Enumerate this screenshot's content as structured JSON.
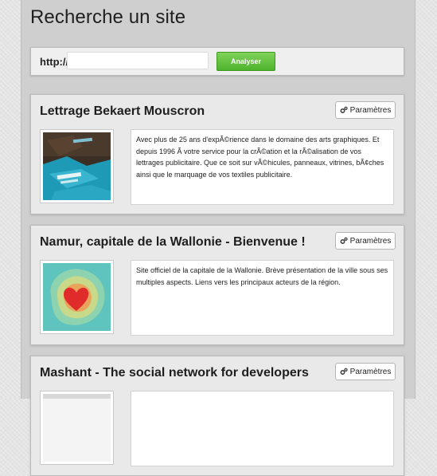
{
  "page": {
    "title": "Recherche un site"
  },
  "search": {
    "label": "http://",
    "value": "",
    "placeholder": "",
    "button_label": "Analyser"
  },
  "results": [
    {
      "title": "Lettrage Bekaert Mouscron",
      "params_label": "Paramètres",
      "thumbnail": "t-shirts-thumbnail",
      "description": "Avec plus de 25 ans d'expÃ©rience dans le domaine des arts graphiques. Et depuis 1996 Ã  votre service pour la crÃ©ation et la rÃ©alisation de vos lettrages publicitaire. Que ce soit sur vÃ©hicules, panneaux, vitrines, bÃ¢ches ainsi que le marquage de vos textiles publicitaire."
    },
    {
      "title": "Namur, capitale de la Wallonie - Bienvenue !",
      "params_label": "Paramètres",
      "thumbnail": "heart-thumbnail",
      "description": "Site officiel de la capitale de la Wallonie. Brève présentation de la ville sous ses multiples aspects. Liens vers les principaux acteurs de la région."
    },
    {
      "title": "Mashant - The social network for developers",
      "params_label": "Paramètres",
      "thumbnail": "screenshot-thumbnail",
      "description": ""
    }
  ],
  "colors": {
    "analyze_button": "#5cbf36",
    "panel": "#cfcfcf",
    "card": "#e9e9e9"
  }
}
